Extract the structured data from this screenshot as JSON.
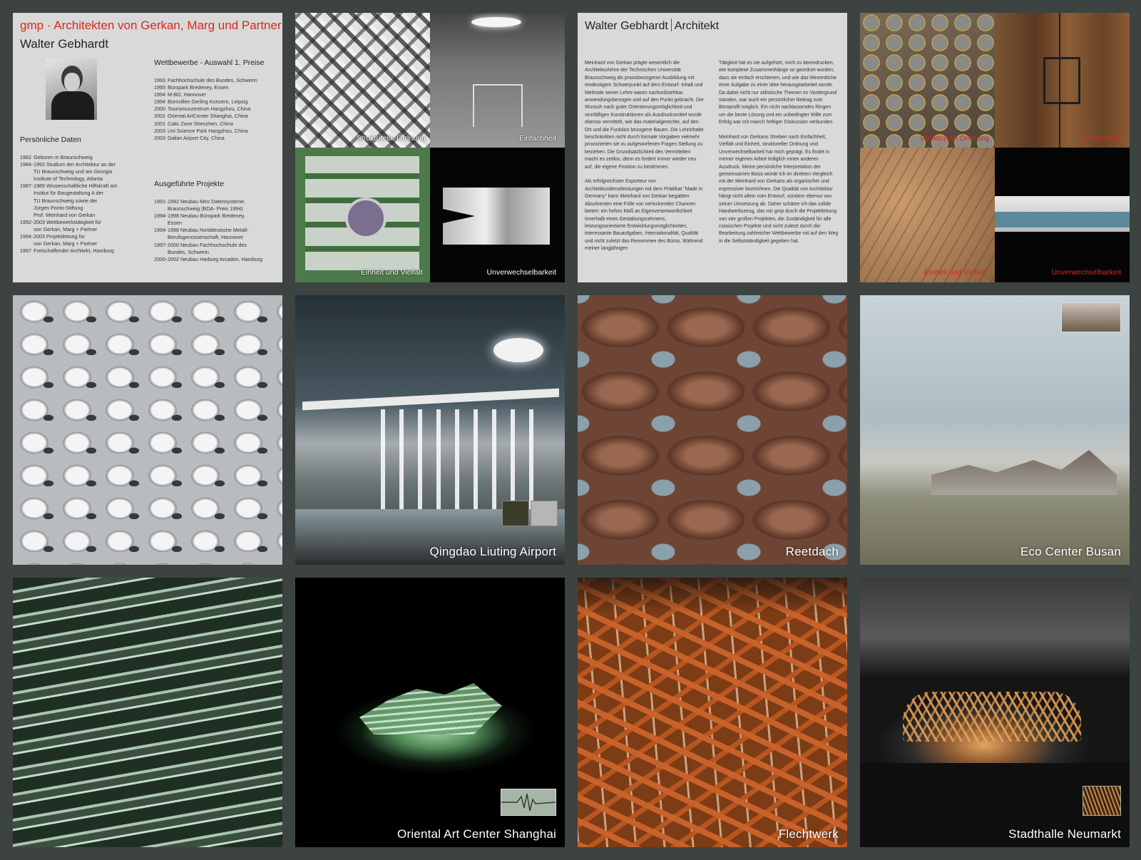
{
  "bio": {
    "firm": "gmp · Architekten von Gerkan, Marg und Partner",
    "name": "Walter Gebhardt",
    "personal_heading": "Persönliche Daten",
    "personal": [
      {
        "year": "1962",
        "text": "Geboren in Braunschweig"
      },
      {
        "year": "1984-",
        "text": "1992 Studium der Architektur an der"
      },
      {
        "year": "",
        "text": "TU Braunschweig und am Georgia"
      },
      {
        "year": "",
        "text": "Institute of Technology, Atlanta"
      },
      {
        "year": "1987-",
        "text": "1989 Wissenschaftliche Hilfskraft am"
      },
      {
        "year": "",
        "text": "Institut für Baugestaltung A der"
      },
      {
        "year": "",
        "text": "TU Braunschweig sowie der"
      },
      {
        "year": "",
        "text": "Jürgen Ponto-Stiftung"
      },
      {
        "year": "",
        "text": "Prof. Meinhard von Gerkan"
      },
      {
        "year": "1992-",
        "text": "2003 Wettbewerbstätigkeit für"
      },
      {
        "year": "",
        "text": "von Gerkan, Marg + Partner"
      },
      {
        "year": "1994-",
        "text": "2003 Projektleitung für"
      },
      {
        "year": "",
        "text": "von Gerkan, Marg + Partner"
      },
      {
        "year": "1997",
        "text": "Freischaffender Architekt, Hamburg"
      }
    ],
    "competitions_heading": "Wettbewerbe - Auswahl 1. Preise",
    "competitions": [
      {
        "year": "1993",
        "text": "Fachhochschule des Bundes, Schwerin"
      },
      {
        "year": "1993",
        "text": "Büropark Bredeney, Essen"
      },
      {
        "year": "1994",
        "text": "M-BG, Hannover"
      },
      {
        "year": "1994",
        "text": "Bürovillen Gerling Konzern, Leipzig"
      },
      {
        "year": "2000",
        "text": "Tourismuszentrum Hangzhou, China"
      },
      {
        "year": "2001",
        "text": "Oriental ArtCenter Shanghai, China"
      },
      {
        "year": "2001",
        "text": "Catic Zone Shenzhen, China"
      },
      {
        "year": "2003",
        "text": "Uni Science Park Hangzhou, China"
      },
      {
        "year": "2003",
        "text": "Dalian Airport City, China"
      }
    ],
    "projects_heading": "Ausgeführte Projekte",
    "projects": [
      {
        "year": "1991-",
        "text": "1992 Neubau Miro Datensysteme,"
      },
      {
        "year": "",
        "text": "Braunschweig (BDA- Preis 1994)"
      },
      {
        "year": "1994-",
        "text": "1998 Neubau Büropark Bredeney,"
      },
      {
        "year": "",
        "text": "Essen"
      },
      {
        "year": "1994-",
        "text": "1998 Neubau Norddeutsche Metall-"
      },
      {
        "year": "",
        "text": "Berufsgenossenschaft, Hannover"
      },
      {
        "year": "1997-",
        "text": "2000 Neubau Fachhochschule des"
      },
      {
        "year": "",
        "text": "Bundes, Schwerin"
      },
      {
        "year": "2000-",
        "text": "2002 Neubau Harburg Arcaden, Hamburg"
      }
    ]
  },
  "quad1": {
    "tl": "Strukturelle Ordnung",
    "tr": "Einfachheit",
    "bl": "Einheit und Vielfalt",
    "br": "Unverwechselbarkeit"
  },
  "essay": {
    "title_a": "Walter Gebhardt",
    "title_b": "Architekt",
    "left_paragraphs": [
      "Meinhard von Gerkan prägte wesentlich die Architekturlehre der Technischen Universität Braunschweig als praxisbezogener Ausbildung mit eindeutigem Schwerpunkt auf dem Entwurf. Inhalt und Methode seiner Lehre waren nachvollziehbar, anwendungsbezogen und auf den Punkt gebracht. Der Wunsch nach guter Orientierungsmöglichkeit und sinnfälligen Konstruktionen als Ausdrucksmittel wurde ebenso vermittelt, wie das materialgerechte, auf den Ort und die Funktion bezogene Bauen. Die Lehrinhalte beschränkten nicht durch formale Vorgaben vielmehr provozierten sie zu aufgeworfenen Fragen Stellung zu beziehen. Die Grundsätzlichkeit des Vermittelten macht es zeitlos, denn es fordert immer wieder neu auf, die eigene Position zu bestimmen.",
      "Als erfolgreichster Exporteur von Architekturdienstleistungen mit dem Prädikat \"Made in Germany\" kann Meinhard von Gerkan begabten Absolventen eine Fülle von verlockenden Chancen bieten: ein hohes Maß an Eigenverantwortlichkeit innerhalb eines Gestaltungsrahmens, leistungsorientierte Entwicklungsmöglichkeiten, interessante Bauaufgaben, Internationalität, Qualität und nicht zuletzt das Renommee des Büros. Während meiner langjährigen"
    ],
    "right_paragraphs": [
      "Tätigkeit hat es nie aufgehört, mich zu beeindrucken, wie komplexe Zusammenhänge so geordnet wurden, dass sie einfach erschienen, und wie das Wesentliche einer Aufgabe zu einer Idee herausgearbeitet wurde. Da dabei nicht nur stilistische Themen im Vordergrund standen, war auch ein persönlicher Beitrag zum Büroprofil möglich. Ein nicht nachlassendes Ringen um die beste Lösung und ein unbedingter Wille zum Erfolg war mit manch heftiger Diskussion verbunden.",
      "Meinhard von Gerkans Streben nach Einfachheit, Vielfalt und Einheit, struktureller Ordnung und Unverwechselbarkeit hat mich geprägt. Es findet in meiner eigenen Arbeit lediglich einen anderen Ausdruck. Meine persönliche Interpretation der gemeinsamen Basis würde ich im direkten Vergleich mit der Meinhard von Gerkans als organischer und expressiver bezeichnen. Die Qualität von Architektur hängt nicht allein vom Entwurf, sondern ebenso von seiner Umsetzung ab. Daher schätze ich das solide Handwerkszeug, das mir gmp durch die Projektleitung von vier großen Projekten, die Zuständigkeit für alle russischen Projekte und nicht zuletzt durch die Bearbeitung zahlreicher Wettbewerbe mit auf den Weg in die Selbstständigkeit gegeben hat."
    ]
  },
  "quad2": {
    "tl": "Strukturelle Ordnung",
    "tr": "Einfachheit",
    "bl": "Einheit und Vielfalt",
    "br": "Unverwechselbarkeit"
  },
  "captions": {
    "airport": "Qingdao Liuting Airport",
    "reed": "Reetdach",
    "eco": "Eco Center Busan",
    "oriental": "Oriental Art Center Shanghai",
    "weave": "Flechtwerk",
    "stadthalle": "Stadthalle Neumarkt"
  },
  "colors": {
    "accent_red": "#d6291f",
    "background": "#3c4340",
    "panel_gray": "#d9d9da"
  }
}
